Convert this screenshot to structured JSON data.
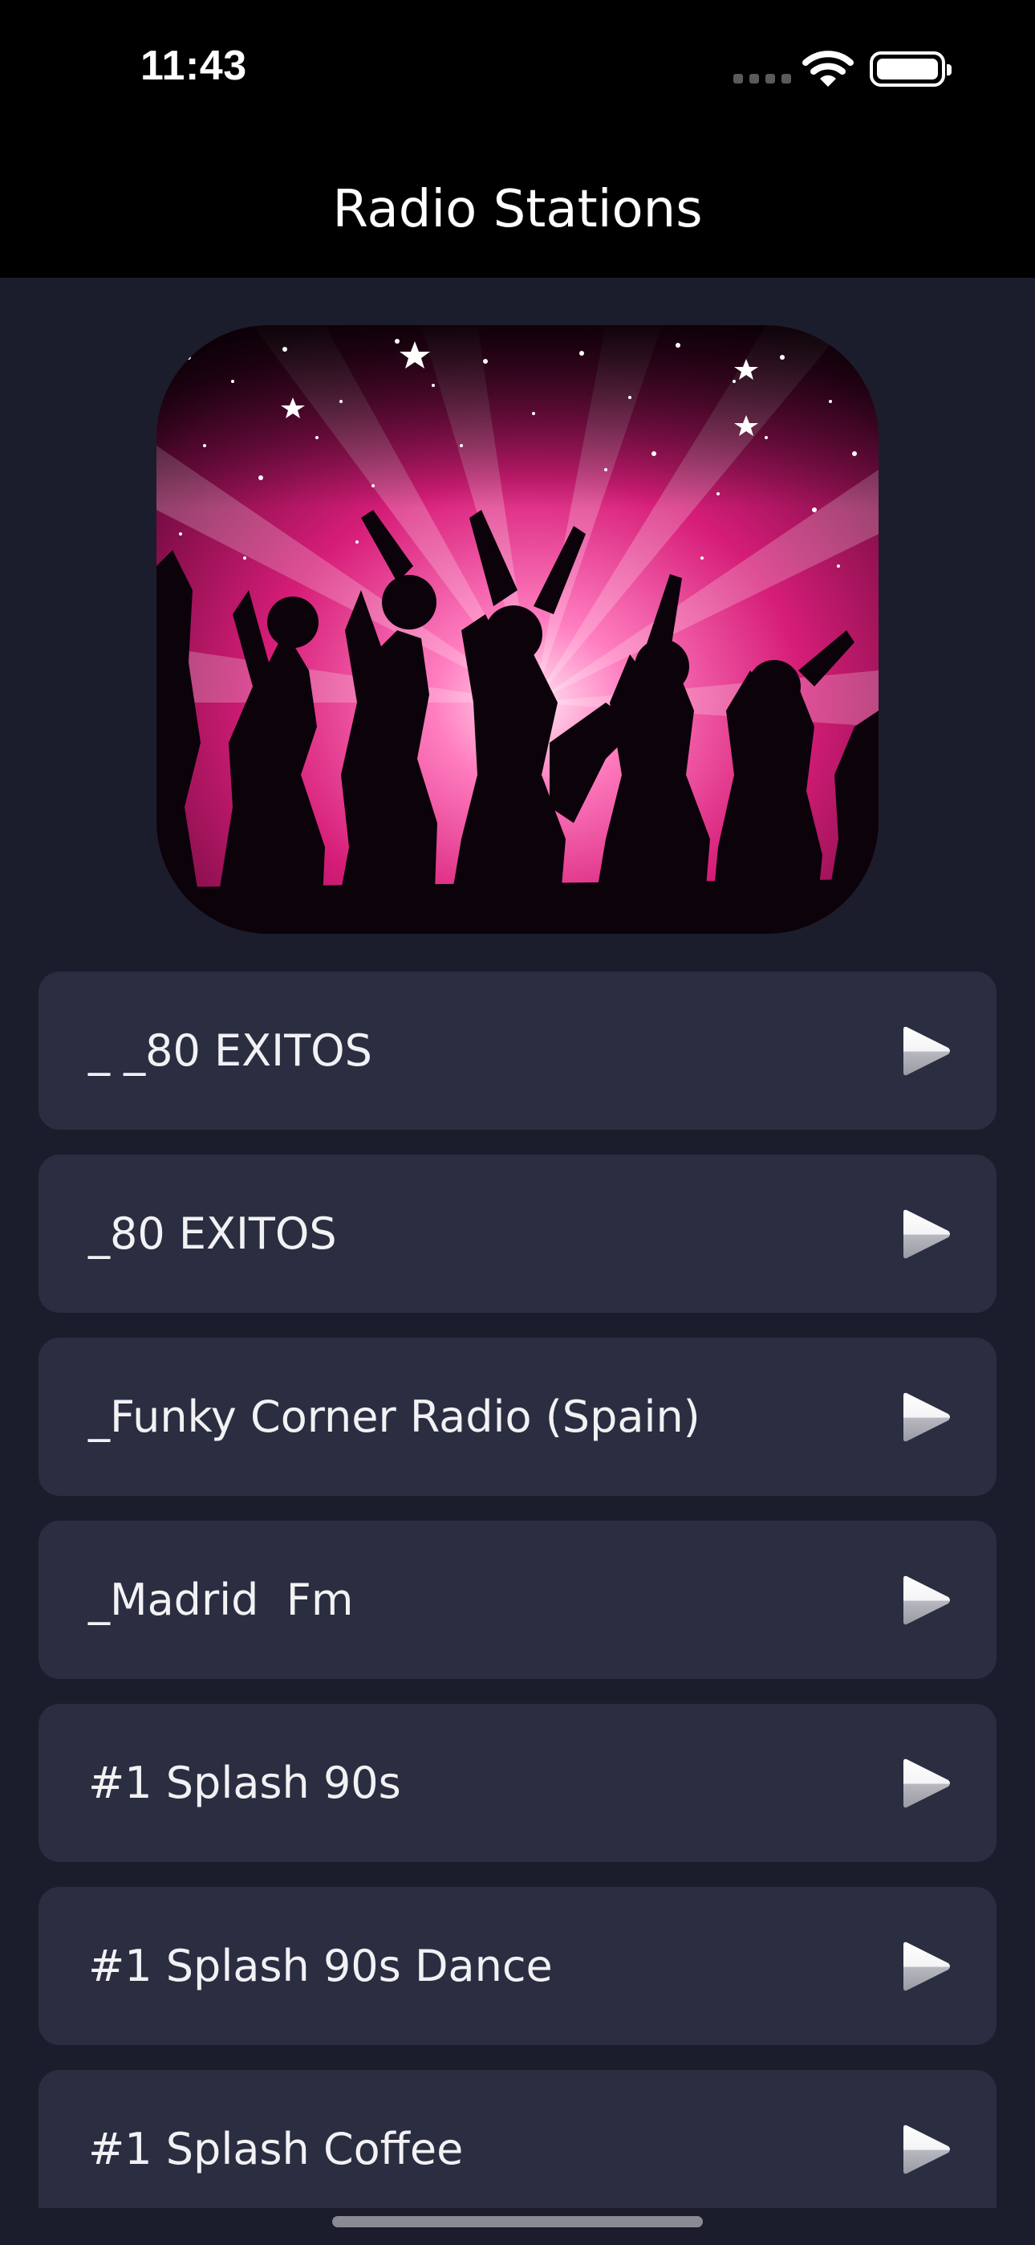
{
  "status_bar": {
    "time": "11:43",
    "icons": [
      "cellular-signal-icon",
      "wifi-icon",
      "battery-icon"
    ],
    "battery_level": 1.0
  },
  "nav": {
    "title": "Radio Stations"
  },
  "artwork": {
    "icon": "dancers-artwork",
    "colors": {
      "accent": "#e0287f",
      "light": "#ff9fd0",
      "dark": "#0c020a"
    }
  },
  "stations": [
    {
      "label": "_ _80 EXITOS",
      "icon": "play-icon"
    },
    {
      "label": "_80 EXITOS",
      "icon": "play-icon"
    },
    {
      "label": "_Funky Corner Radio (Spain)",
      "icon": "play-icon"
    },
    {
      "label": "_Madrid  Fm",
      "icon": "play-icon"
    },
    {
      "label": "#1 Splash 90s",
      "icon": "play-icon"
    },
    {
      "label": "#1 Splash 90s Dance",
      "icon": "play-icon"
    },
    {
      "label": "#1 Splash Coffee",
      "icon": "play-icon"
    }
  ],
  "theme": {
    "background": "#1b1d2c",
    "row_background": "#2b2e41",
    "bar_background": "#000000",
    "text": "#f2f2f5"
  }
}
